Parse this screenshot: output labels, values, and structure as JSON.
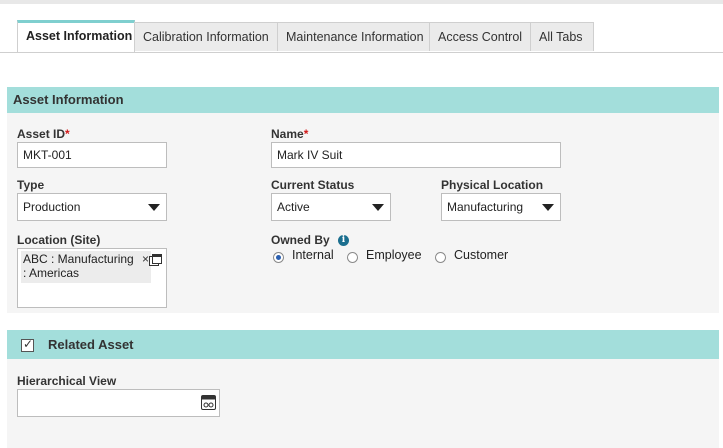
{
  "tabs": [
    {
      "label": "Asset Information",
      "active": true
    },
    {
      "label": "Calibration Information",
      "active": false
    },
    {
      "label": "Maintenance Information",
      "active": false
    },
    {
      "label": "Access Control",
      "active": false
    },
    {
      "label": "All Tabs",
      "active": false
    }
  ],
  "asset_info": {
    "header": "Asset Information",
    "asset_id": {
      "label": "Asset ID",
      "required_mark": "*",
      "value": "MKT-001"
    },
    "name": {
      "label": "Name",
      "required_mark": "*",
      "value": "Mark IV Suit"
    },
    "type": {
      "label": "Type",
      "value": "Production"
    },
    "current_status": {
      "label": "Current Status",
      "value": "Active"
    },
    "physical_location": {
      "label": "Physical Location",
      "value": "Manufacturing"
    },
    "location_site": {
      "label": "Location (Site)",
      "chip_line1": "ABC : Manufacturing",
      "chip_line2": ": Americas",
      "remove_glyph": "×"
    },
    "owned_by": {
      "label": "Owned By",
      "info_glyph": "i",
      "options": [
        {
          "label": "Internal",
          "checked": true
        },
        {
          "label": "Employee",
          "checked": false
        },
        {
          "label": "Customer",
          "checked": false
        }
      ]
    }
  },
  "related_asset": {
    "header": "Related Asset",
    "checked": true,
    "hierarchical_view": {
      "label": "Hierarchical View",
      "value": ""
    }
  },
  "colors": {
    "section_header": "#a3dedb",
    "tab_accent": "#7fcfcf",
    "panel_bg": "#f5f5f5",
    "required": "#d21a1a"
  },
  "icons": {
    "location_picker": "window-icon",
    "hierarchy_picker": "tree-picker-icon",
    "owned_by_help": "info-icon"
  }
}
